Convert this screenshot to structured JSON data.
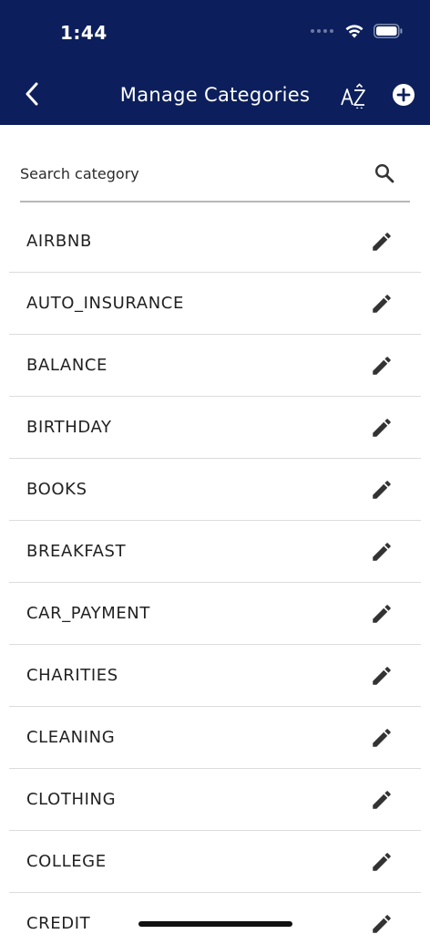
{
  "status": {
    "time": "1:44"
  },
  "header": {
    "title": "Manage Categories"
  },
  "search": {
    "placeholder": "Search category"
  },
  "categories": [
    "AIRBNB",
    "AUTO_INSURANCE",
    "BALANCE",
    "BIRTHDAY",
    "BOOKS",
    "BREAKFAST",
    "CAR_PAYMENT",
    "CHARITIES",
    "CLEANING",
    "CLOTHING",
    "COLLEGE",
    "CREDIT"
  ],
  "colors": {
    "header_bg": "#0c1f5c",
    "text": "#222222",
    "divider": "#dcdcdc"
  },
  "icons": {
    "back": "chevron-left-icon",
    "sort": "sort-az-icon",
    "add": "plus-circle-icon",
    "search": "search-icon",
    "edit": "pencil-icon"
  }
}
